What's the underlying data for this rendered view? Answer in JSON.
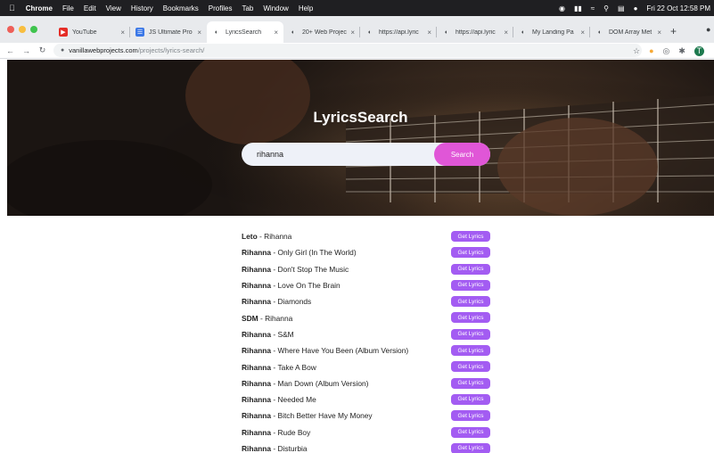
{
  "menubar": {
    "items": [
      "Chrome",
      "File",
      "Edit",
      "View",
      "History",
      "Bookmarks",
      "Profiles",
      "Tab",
      "Window",
      "Help"
    ],
    "clock": "Fri 22 Oct  12:58 PM"
  },
  "tabs": [
    {
      "label": "YouTube",
      "icon": "youtube-icon",
      "color": "#e52d27",
      "active": false
    },
    {
      "label": "JS Ultimate Pro",
      "icon": "document-icon",
      "color": "#3b78e7",
      "active": false
    },
    {
      "label": "LyricsSearch",
      "icon": "globe-icon",
      "color": "#5f6368",
      "active": true
    },
    {
      "label": "20+ Web Projec",
      "icon": "globe-icon",
      "color": "#5f6368",
      "active": false
    },
    {
      "label": "https://api.lyric",
      "icon": "globe-icon",
      "color": "#5f6368",
      "active": false
    },
    {
      "label": "https://api.lyric",
      "icon": "globe-icon",
      "color": "#5f6368",
      "active": false
    },
    {
      "label": "My Landing Pa",
      "icon": "globe-icon",
      "color": "#5f6368",
      "active": false
    },
    {
      "label": "DOM Array Met",
      "icon": "globe-icon",
      "color": "#5f6368",
      "active": false
    }
  ],
  "address": {
    "host": "vanillawebprojects.com",
    "path": "/projects/lyrics-search/"
  },
  "hero": {
    "title": "LyricsSearch"
  },
  "search": {
    "value": "rihanna",
    "button_label": "Search"
  },
  "results": {
    "button_label": "Get Lyrics",
    "items": [
      {
        "artist": "Leto",
        "title": "Rihanna"
      },
      {
        "artist": "Rihanna",
        "title": "Only Girl (In The World)"
      },
      {
        "artist": "Rihanna",
        "title": "Don't Stop The Music"
      },
      {
        "artist": "Rihanna",
        "title": "Love On The Brain"
      },
      {
        "artist": "Rihanna",
        "title": "Diamonds"
      },
      {
        "artist": "SDM",
        "title": "Rihanna"
      },
      {
        "artist": "Rihanna",
        "title": "S&M"
      },
      {
        "artist": "Rihanna",
        "title": "Where Have You Been (Album Version)"
      },
      {
        "artist": "Rihanna",
        "title": "Take A Bow"
      },
      {
        "artist": "Rihanna",
        "title": "Man Down (Album Version)"
      },
      {
        "artist": "Rihanna",
        "title": "Needed Me"
      },
      {
        "artist": "Rihanna",
        "title": "Bitch Better Have My Money"
      },
      {
        "artist": "Rihanna",
        "title": "Rude Boy"
      },
      {
        "artist": "Rihanna",
        "title": "Disturbia"
      }
    ]
  },
  "colors": {
    "search_button": "#e056d7",
    "lyrics_button": "#a35cf2"
  }
}
